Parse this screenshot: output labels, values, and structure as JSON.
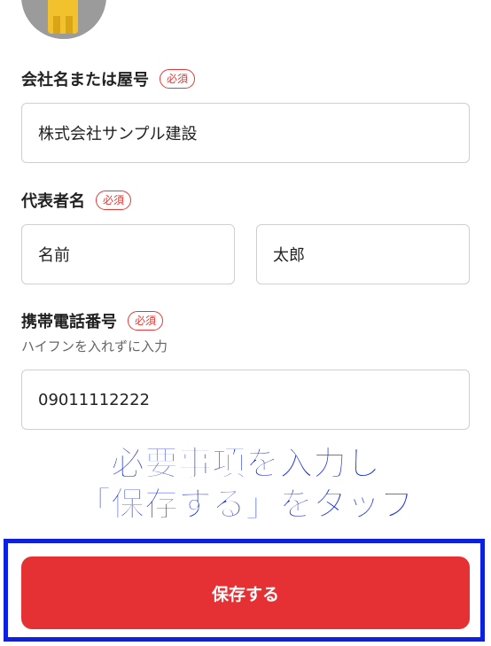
{
  "company": {
    "label": "会社名または屋号",
    "badge": "必須",
    "value": "株式会社サンプル建設"
  },
  "representative": {
    "label": "代表者名",
    "badge": "必須",
    "last_name": "名前",
    "first_name": "太郎"
  },
  "phone": {
    "label": "携帯電話番号",
    "badge": "必須",
    "helper": "ハイフンを入れずに入力",
    "value": "09011112222"
  },
  "instruction": {
    "line1": "必要事項を入力し",
    "line2": "「保存する」をタップ"
  },
  "save_button": {
    "label": "保存する"
  },
  "colors": {
    "accent_red": "#e53133",
    "badge_red": "#e53935",
    "instruction_blue": "#1a2ee0",
    "highlight_blue": "#0d1fe0"
  }
}
